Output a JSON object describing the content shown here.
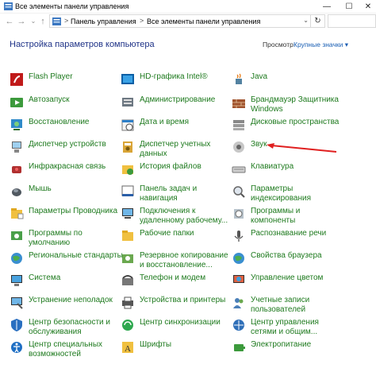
{
  "window": {
    "title": "Все элементы панели управления",
    "minimize_glyph": "—",
    "maximize_glyph": "☐",
    "close_glyph": "✕"
  },
  "address": {
    "crumb1": "Панель управления",
    "crumb2": "Все элементы панели управления",
    "separator": ">",
    "refresh_glyph": "↻"
  },
  "header": {
    "title": "Настройка параметров компьютера",
    "view_label": "Просмотр:",
    "view_value": "Крупные значки ▾"
  },
  "colors": {
    "link_green": "#1e7a1e",
    "title_blue": "#1e3287",
    "arrow_red": "#e02020"
  },
  "items": {
    "col1": [
      {
        "label": "Flash Player",
        "icon": "flash-player-icon"
      },
      {
        "label": "Автозапуск",
        "icon": "autoplay-icon"
      },
      {
        "label": "Восстановление",
        "icon": "recovery-icon"
      },
      {
        "label": "Диспетчер устройств",
        "icon": "device-manager-icon"
      },
      {
        "label": "Инфракрасная связь",
        "icon": "infrared-icon"
      },
      {
        "label": "Мышь",
        "icon": "mouse-icon"
      },
      {
        "label": "Параметры Проводника",
        "icon": "explorer-options-icon"
      },
      {
        "label": "Программы по\nумолчанию",
        "icon": "default-programs-icon"
      },
      {
        "label": "Региональные стандарты",
        "icon": "region-icon"
      },
      {
        "label": "Система",
        "icon": "system-icon"
      },
      {
        "label": "Устранение неполадок",
        "icon": "troubleshooting-icon"
      },
      {
        "label": "Центр безопасности и\nобслуживания",
        "icon": "security-maintenance-icon"
      },
      {
        "label": "Центр специальных\nвозможностей",
        "icon": "ease-of-access-icon"
      }
    ],
    "col2": [
      {
        "label": "HD-графика Intel®",
        "icon": "intel-graphics-icon"
      },
      {
        "label": "Администрирование",
        "icon": "administrative-tools-icon"
      },
      {
        "label": "Дата и время",
        "icon": "date-time-icon"
      },
      {
        "label": "Диспетчер учетных\nданных",
        "icon": "credential-manager-icon"
      },
      {
        "label": "История файлов",
        "icon": "file-history-icon"
      },
      {
        "label": "Панель задач и\nнавигация",
        "icon": "taskbar-icon"
      },
      {
        "label": "Подключения к\nудаленному рабочему...",
        "icon": "remoteapp-icon"
      },
      {
        "label": "Рабочие папки",
        "icon": "work-folders-icon"
      },
      {
        "label": "Резервное копирование\nи восстановление...",
        "icon": "backup-restore-icon"
      },
      {
        "label": "Телефон и модем",
        "icon": "phone-modem-icon"
      },
      {
        "label": "Устройства и принтеры",
        "icon": "devices-printers-icon"
      },
      {
        "label": "Центр синхронизации",
        "icon": "sync-center-icon"
      },
      {
        "label": "Шрифты",
        "icon": "fonts-icon"
      }
    ],
    "col3": [
      {
        "label": "Java",
        "icon": "java-icon"
      },
      {
        "label": "Брандмауэр Защитника\nWindows",
        "icon": "firewall-icon"
      },
      {
        "label": "Дисковые пространства",
        "icon": "storage-spaces-icon"
      },
      {
        "label": "Звук",
        "icon": "sound-icon"
      },
      {
        "label": "Клавиатура",
        "icon": "keyboard-icon"
      },
      {
        "label": "Параметры\nиндексирования",
        "icon": "indexing-icon"
      },
      {
        "label": "Программы и\nкомпоненты",
        "icon": "programs-features-icon"
      },
      {
        "label": "Распознавание речи",
        "icon": "speech-icon"
      },
      {
        "label": "Свойства браузера",
        "icon": "internet-options-icon"
      },
      {
        "label": "Управление цветом",
        "icon": "color-management-icon"
      },
      {
        "label": "Учетные записи\nпользователей",
        "icon": "user-accounts-icon"
      },
      {
        "label": "Центр управления\nсетями и общим...",
        "icon": "network-sharing-icon"
      },
      {
        "label": "Электропитание",
        "icon": "power-options-icon"
      }
    ]
  }
}
